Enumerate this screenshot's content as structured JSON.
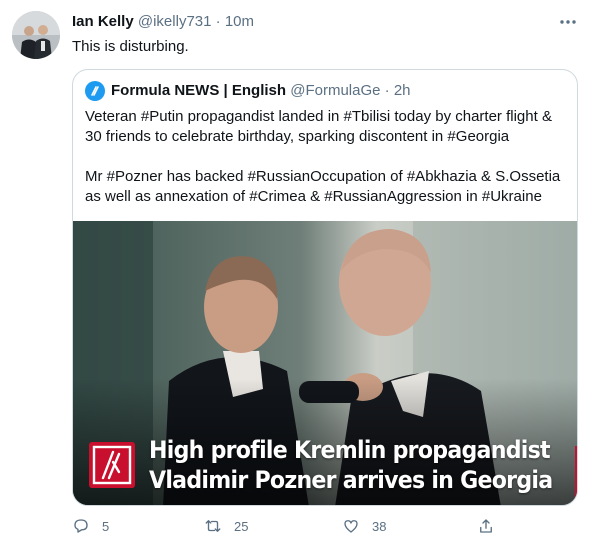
{
  "tweet": {
    "author_name": "Ian Kelly",
    "handle": "@ikelly731",
    "separator": "·",
    "time": "10m",
    "text": "This is disturbing.",
    "more_icon": "ellipsis-icon"
  },
  "quote": {
    "author_name": "Formula NEWS | English",
    "handle": "@FormulaGe",
    "separator": "·",
    "time": "2h",
    "para1_line1": "Veteran #Putin propagandist landed in #Tbilisi today by charter flight &",
    "para1_line2": "30 friends to celebrate birthday, sparking discontent in #Georgia",
    "para2_line1": "Mr #Pozner has backed #RussianOccupation of #Abkhazia & S.Ossetia",
    "para2_line2": "as well as annexation of #Crimea & #RussianAggression in #Ukraine",
    "media": {
      "headline_line1": "High profile Kremlin propagandist",
      "headline_line2": "Vladimir Pozner arrives in Georgia",
      "brand_color": "#c8102e"
    }
  },
  "actions": {
    "reply_count": "5",
    "retweet_count": "25",
    "like_count": "38"
  },
  "colors": {
    "accent": "#1d9bf0",
    "secondary_text": "#5b7083",
    "border": "#cfd9de"
  }
}
